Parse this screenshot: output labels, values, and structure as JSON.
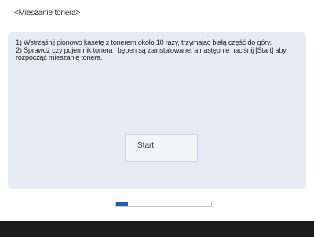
{
  "screen": {
    "title": "<Mieszanie tonera>"
  },
  "instructions": {
    "step1": "1) Wstrząśnij pionowo kasetę z tonerem około 10 razy, trzymając białą część do góry.",
    "step2": "2) Sprawdź czy pojemnik tonera i bęben są zainstalowane, a następnie naciśnij [Start] aby rozpocząć mieszanie tonera."
  },
  "buttons": {
    "start_label": "Start"
  },
  "progress": {
    "value": 0.12,
    "color": "#1f5fb8"
  },
  "colors": {
    "panel_background": "#e7ebf3",
    "bottom_bar": "#1b1b1b"
  }
}
